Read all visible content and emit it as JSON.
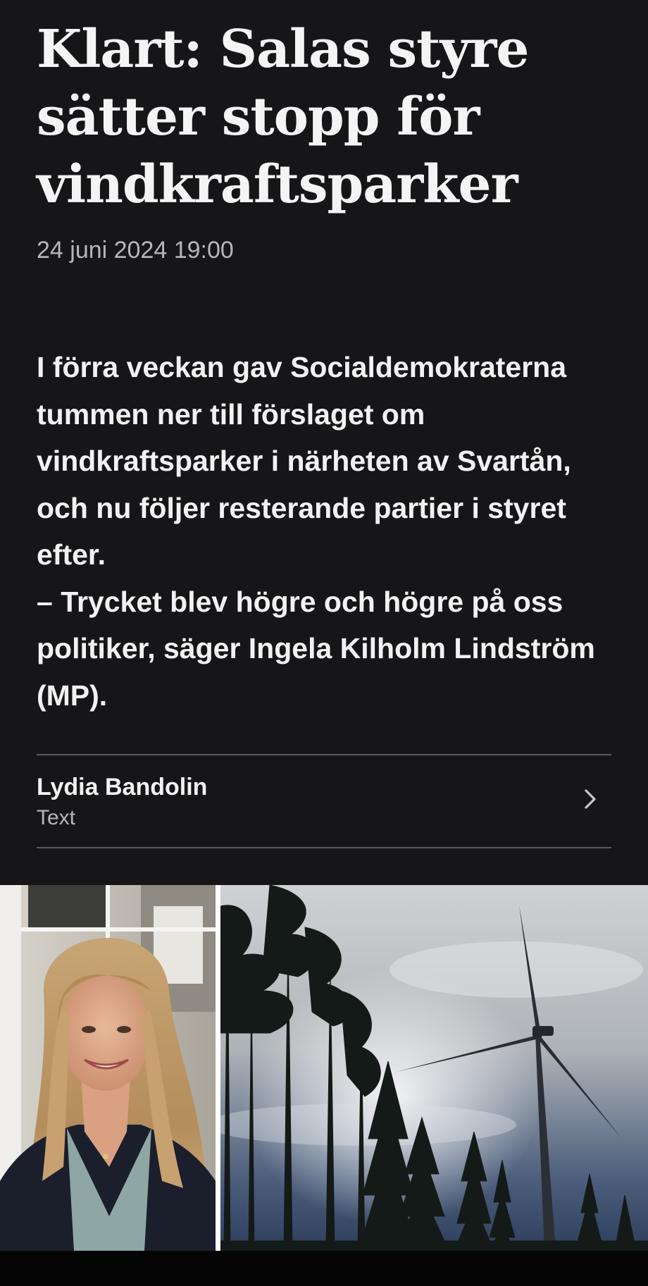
{
  "article": {
    "headline": "Klart: Salas styre sätter stopp för vindkraftsparker",
    "date": "24 juni 2024 19:00",
    "lead": "I förra veckan gav Socialdemokraterna tummen ner till förslaget om vindkraftsparker i närheten av Svartån, och nu följer resterande partier i styret efter.\n– Trycket blev högre och högre på oss politiker, säger Ingela Kilholm Lindström (MP)."
  },
  "byline": {
    "name": "Lydia Bandolin",
    "role": "Text",
    "icon": "chevron-right-icon"
  },
  "images": {
    "left": "portrait-photo",
    "right": "wind-turbine-photo"
  },
  "colors": {
    "background": "#161618",
    "text": "#f2f2f2",
    "muted": "#b6b6bb",
    "divider": "#5a5a5e"
  }
}
